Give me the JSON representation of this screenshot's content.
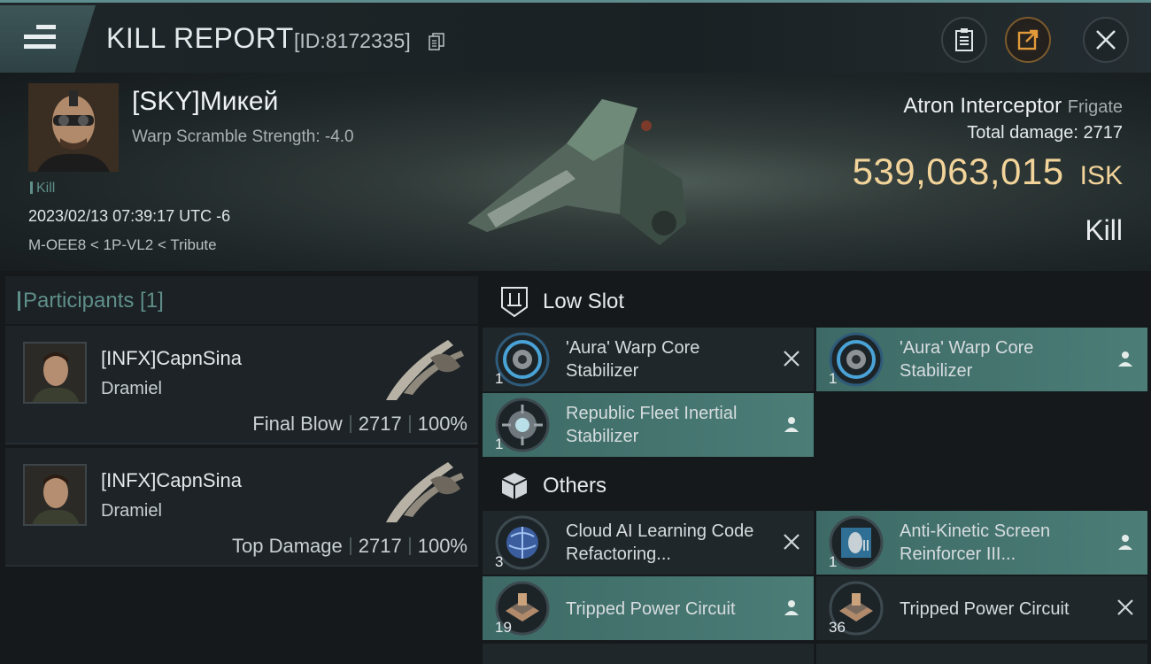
{
  "header": {
    "title": "KILL REPORT",
    "id_text": "[ID:8172335]"
  },
  "victim": {
    "name": "[SKY]Микей",
    "warp_scramble": "Warp Scramble Strength: -4.0",
    "kill_tag": "Kill",
    "datetime": "2023/02/13 07:39:17 UTC -6",
    "location": "M-OEE8 < 1P-VL2 < Tribute",
    "ship_name": "Atron Interceptor",
    "ship_class": "Frigate",
    "total_damage_label": "Total damage:",
    "total_damage": "2717",
    "isk_value": "539,063,015",
    "isk_unit": "ISK",
    "result": "Kill"
  },
  "participants": {
    "title": "Participants [1]",
    "items": [
      {
        "name": "[INFX]CapnSina",
        "ship": "Dramiel",
        "role": "Final Blow",
        "damage": "2717",
        "percent": "100%"
      },
      {
        "name": "[INFX]CapnSina",
        "ship": "Dramiel",
        "role": "Top Damage",
        "damage": "2717",
        "percent": "100%"
      }
    ]
  },
  "sections": {
    "low_slot": "Low Slot",
    "others": "Others"
  },
  "modules": {
    "low": [
      {
        "name": "'Aura' Warp Core Stabilizer",
        "qty": "1",
        "status": "destroyed"
      },
      {
        "name": "'Aura' Warp Core Stabilizer",
        "qty": "1",
        "status": "dropped"
      },
      {
        "name": "Republic Fleet Inertial Stabilizer",
        "qty": "1",
        "status": "dropped"
      }
    ],
    "others": [
      {
        "name": "Cloud AI Learning Code Refactoring...",
        "qty": "3",
        "status": "destroyed"
      },
      {
        "name": "Anti-Kinetic Screen Reinforcer III...",
        "qty": "1",
        "status": "dropped"
      },
      {
        "name": "Tripped Power Circuit",
        "qty": "19",
        "status": "dropped"
      },
      {
        "name": "Tripped Power Circuit",
        "qty": "36",
        "status": "destroyed"
      }
    ]
  },
  "colors": {
    "accent": "#5f8f8a",
    "isk": "#f2d49a",
    "dropped_bg": "#4c7d77"
  }
}
